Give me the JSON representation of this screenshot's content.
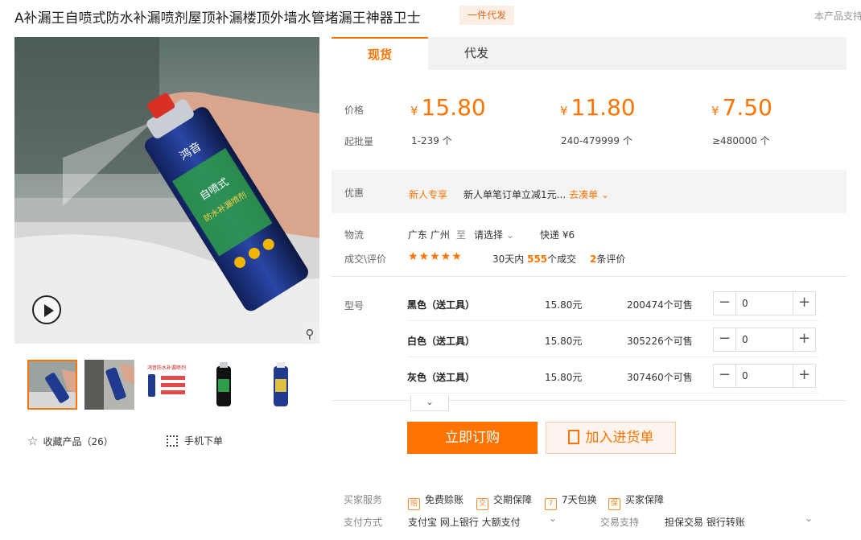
{
  "product": {
    "title": "A补漏王自喷式防水补漏喷剂屋顶补漏楼顶外墙水管堵漏王神器卫士",
    "badge": "一件代发",
    "support": "本产品支持"
  },
  "gallery": {
    "thumbs": [
      "thumb-1",
      "thumb-2",
      "thumb-3",
      "thumb-4",
      "thumb-5"
    ],
    "can_label": "鸿音",
    "can_brand": "自喷式",
    "can_name": "防水补漏喷剂",
    "flyer_title": "鸿音防水补漏喷剂"
  },
  "actions": {
    "favorite": "收藏产品（26）",
    "mobile": "手机下单"
  },
  "tabs": [
    {
      "label": "现货",
      "active": true
    },
    {
      "label": "代发",
      "active": false
    }
  ],
  "pricing": {
    "price_label": "价格",
    "moq_label": "起批量",
    "currency": "¥",
    "tiers": [
      {
        "price": "15.80",
        "range": "1-239 个"
      },
      {
        "price": "11.80",
        "range": "240-479999 个"
      },
      {
        "price": "7.50",
        "range": "≥480000 个"
      }
    ]
  },
  "promo": {
    "label": "优惠",
    "tag": "新人专享",
    "text": "新人单笔订单立减1元...",
    "link": "去凑单"
  },
  "logistics": {
    "label": "物流",
    "from": "广东 广州",
    "to_word": "至",
    "destination": "请选择",
    "shipping": "快递 ¥6"
  },
  "reviews": {
    "label": "成交\\评价",
    "stars": "★★★★★",
    "deals_prefix": "30天内",
    "deals_count": "555",
    "deals_suffix": "个成交",
    "review_count": "2",
    "review_suffix": "条评价"
  },
  "sku": {
    "label": "型号",
    "rows": [
      {
        "name": "黑色（送工具）",
        "price": "15.80元",
        "stock": "200474个可售",
        "qty": "0"
      },
      {
        "name": "白色（送工具）",
        "price": "15.80元",
        "stock": "305226个可售",
        "qty": "0"
      },
      {
        "name": "灰色（送工具）",
        "price": "15.80元",
        "stock": "307460个可售",
        "qty": "0"
      }
    ]
  },
  "buttons": {
    "buy": "立即订购",
    "cart": "加入进货单"
  },
  "services": {
    "label": "买家服务",
    "items": [
      {
        "icon": "赔",
        "label": "免费赊账"
      },
      {
        "icon": "交",
        "label": "交期保障"
      },
      {
        "icon": "7",
        "label": "7天包换"
      },
      {
        "icon": "保",
        "label": "买家保障"
      }
    ]
  },
  "payment": {
    "label": "支付方式",
    "methods": "支付宝   网上银行   大额支付",
    "trade_label": "交易支持",
    "trade_methods": "担保交易   银行转账"
  },
  "colors": {
    "accent": "#ff7300",
    "badge_bg": "#fbeee5"
  }
}
